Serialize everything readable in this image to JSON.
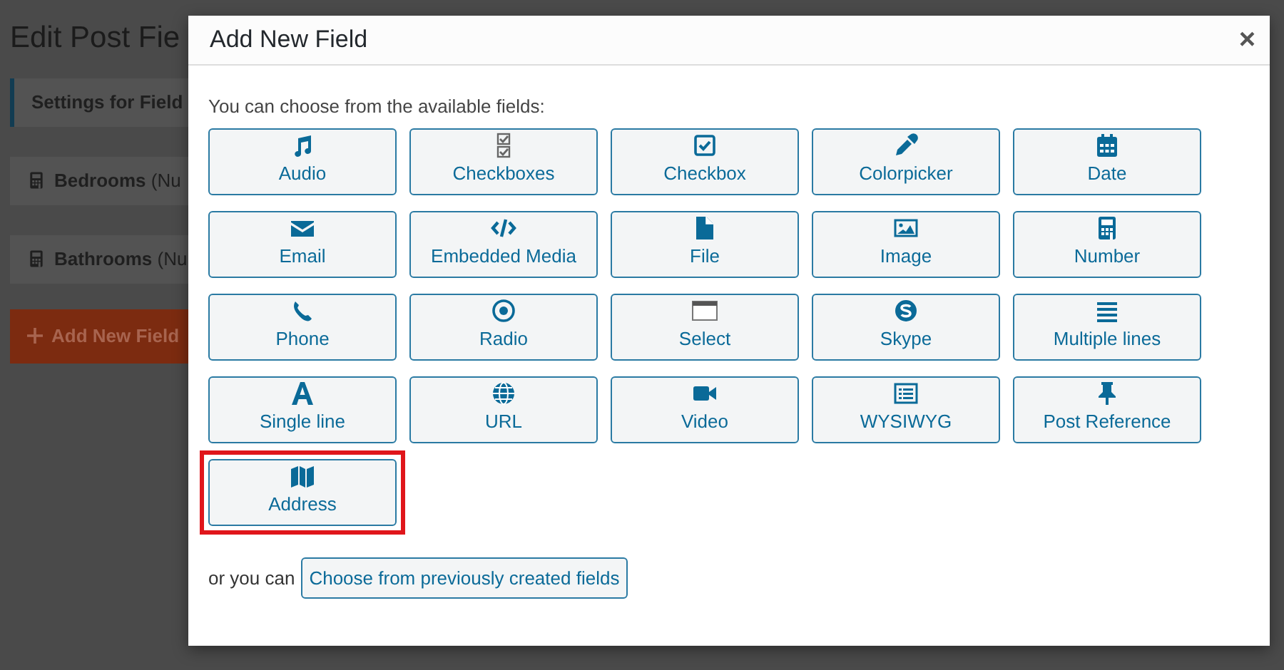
{
  "page": {
    "title": "Edit Post Fie",
    "settings_label": "Settings for Field",
    "field_rows": [
      {
        "text": "**Bedrooms** (Nu"
      },
      {
        "text": "**Bathrooms** (Nu"
      }
    ],
    "add_button": "Add New Field"
  },
  "modal": {
    "title": "Add New Field",
    "close": "×",
    "intro": "You can choose from the available fields:",
    "fields": [
      {
        "label": "Audio",
        "kind": "audio"
      },
      {
        "label": "Checkboxes",
        "kind": "checkboxes"
      },
      {
        "label": "Checkbox",
        "kind": "checkbox"
      },
      {
        "label": "Colorpicker",
        "kind": "colorpicker"
      },
      {
        "label": "Date",
        "kind": "date"
      },
      {
        "label": "Email",
        "kind": "email"
      },
      {
        "label": "Embedded Media",
        "kind": "embed"
      },
      {
        "label": "File",
        "kind": "file"
      },
      {
        "label": "Image",
        "kind": "image"
      },
      {
        "label": "Number",
        "kind": "number"
      },
      {
        "label": "Phone",
        "kind": "phone"
      },
      {
        "label": "Radio",
        "kind": "radio"
      },
      {
        "label": "Select",
        "kind": "select"
      },
      {
        "label": "Skype",
        "kind": "skype"
      },
      {
        "label": "Multiple lines",
        "kind": "lines"
      },
      {
        "label": "Single line",
        "kind": "singleline"
      },
      {
        "label": "URL",
        "kind": "url"
      },
      {
        "label": "Video",
        "kind": "video"
      },
      {
        "label": "WYSIWYG",
        "kind": "wysiwyg"
      },
      {
        "label": "Post Reference",
        "kind": "pin"
      },
      {
        "label": "Address",
        "kind": "map",
        "highlighted": true
      }
    ],
    "footer_text": "or you can",
    "footer_button": "Choose from previously created fields"
  }
}
